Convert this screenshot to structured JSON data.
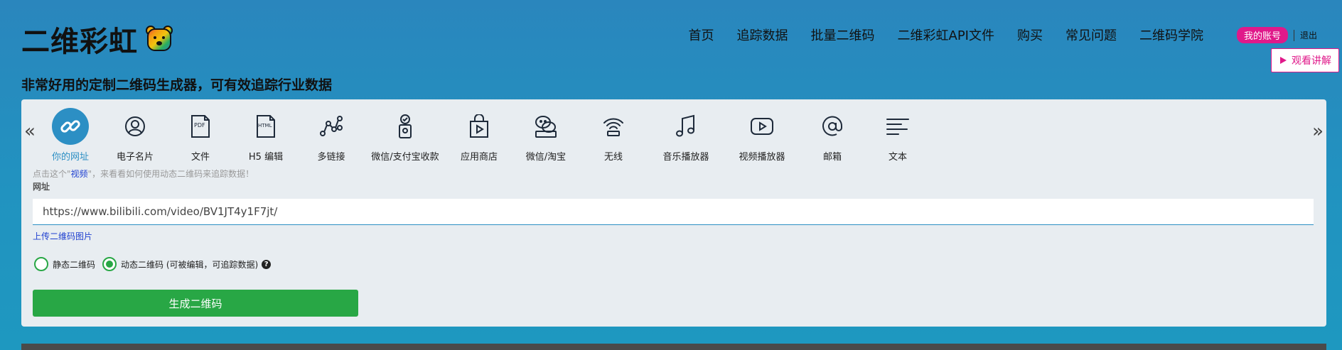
{
  "header": {
    "logo_text": "二维彩虹",
    "nav": [
      "首页",
      "追踪数据",
      "批量二维码",
      "二维彩虹API文件",
      "购买",
      "常见问题",
      "二维码学院"
    ],
    "account_label": "我的账号",
    "logout_label": "退出",
    "video_label": "观看讲解"
  },
  "tagline": "非常好用的定制二维码生成器，可有效追踪行业数据",
  "types": [
    {
      "label": "你的网址",
      "icon": "link-icon",
      "active": true
    },
    {
      "label": "电子名片",
      "icon": "user-icon"
    },
    {
      "label": "文件",
      "icon": "pdf-icon"
    },
    {
      "label": "H5 编辑",
      "icon": "html-icon"
    },
    {
      "label": "多链接",
      "icon": "multilink-icon"
    },
    {
      "label": "微信/支付宝收款",
      "icon": "payment-icon"
    },
    {
      "label": "应用商店",
      "icon": "app-store-icon"
    },
    {
      "label": "微信/淘宝",
      "icon": "wechat-icon"
    },
    {
      "label": "无线",
      "icon": "wifi-icon"
    },
    {
      "label": "音乐播放器",
      "icon": "music-icon"
    },
    {
      "label": "视频播放器",
      "icon": "video-icon"
    },
    {
      "label": "邮箱",
      "icon": "email-icon"
    },
    {
      "label": "文本",
      "icon": "text-icon"
    }
  ],
  "hint": {
    "prefix": "点击这个\"",
    "link": "视频",
    "suffix": "\"，来看看如何使用动态二维码来追踪数据！"
  },
  "form": {
    "field_label": "网址",
    "url_value": "https://www.bilibili.com/video/BV1JT4y1F7jt/",
    "upload_label": "上传二维码图片",
    "static_label": "静态二维码",
    "dynamic_label": "动态二维码 (可被编辑，可追踪数据)",
    "generate_label": "生成二维码"
  },
  "colors": {
    "accent": "#2c8fc4",
    "pink": "#e0198a",
    "green": "#28a745"
  }
}
